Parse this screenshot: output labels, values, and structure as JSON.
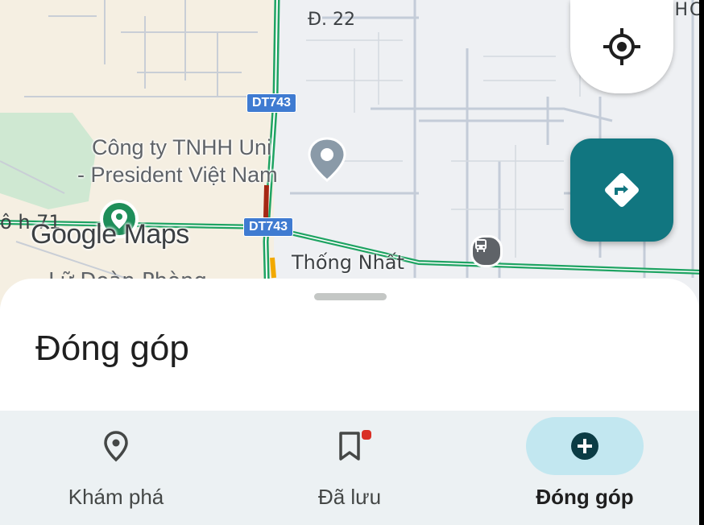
{
  "map": {
    "road_labels": {
      "d22": "Đ. 22",
      "th": "THC",
      "thong_nhat": "Thống Nhất",
      "partial_left": "ô h   71",
      "partial_bottom": "Lữ Đoàn Phòng"
    },
    "shields": {
      "dt743_top": "DT743",
      "dt743_mid": "DT743"
    },
    "poi": {
      "line1": "Công ty TNHH Uni",
      "line2": "- President Việt Nam"
    },
    "logo": "Google Maps",
    "colors": {
      "road_green": "#1ea362",
      "road_red": "#a52714",
      "accent_teal": "#117680"
    }
  },
  "buttons": {
    "my_location_icon": "crosshair-icon",
    "directions_icon": "directions-icon"
  },
  "sheet": {
    "title": "Đóng góp"
  },
  "nav": {
    "items": [
      {
        "label": "Khám phá",
        "icon": "location-pin-icon"
      },
      {
        "label": "Đã lưu",
        "icon": "bookmark-icon"
      },
      {
        "label": "Đóng góp",
        "icon": "add-circle-icon"
      }
    ],
    "active_color": "#c2e7f0"
  }
}
